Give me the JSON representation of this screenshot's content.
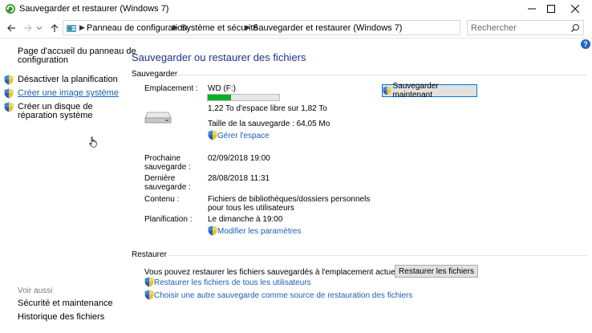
{
  "window": {
    "title": "Sauvegarder et restaurer (Windows 7)"
  },
  "address": {
    "breadcrumbs": [
      "Panneau de configuration",
      "Système et sécurité",
      "Sauvegarder et restaurer (Windows 7)"
    ],
    "search_placeholder": "Rechercher"
  },
  "sidebar": {
    "home_link": "Page d'accueil du panneau de configuration",
    "items": [
      {
        "label": "Désactiver la planification",
        "shield": true
      },
      {
        "label": "Créer une image système",
        "shield": true
      },
      {
        "label": "Créer un disque de réparation système",
        "shield": true
      }
    ],
    "see_also_label": "Voir aussi",
    "see_also_links": [
      "Sécurité et maintenance",
      "Historique des fichiers"
    ]
  },
  "main": {
    "title": "Sauvegarder ou restaurer des fichiers",
    "backup": {
      "section_label": "Sauvegarder",
      "location_label": "Emplacement :",
      "drive_name": "WD (F:)",
      "drive_usage_fraction": 0.33,
      "free_space": "1,22 To d'espace libre sur 1,82 To",
      "backup_size": "Taille de la sauvegarde : 64,05 Mo",
      "manage_space_link": "Gérer l'espace",
      "backup_now_button": "Sauvegarder maintenant",
      "next_backup_label": "Prochaine sauvegarde :",
      "next_backup_value": "02/09/2018 19:00",
      "last_backup_label": "Dernière sauvegarde :",
      "last_backup_value": "28/08/2018 11:31",
      "contents_label": "Contenu :",
      "contents_value": "Fichiers de bibliothèques/dossiers personnels pour tous les utilisateurs",
      "schedule_label": "Planification :",
      "schedule_value": "Le dimanche à 19:00",
      "change_settings_link": "Modifier les paramètres"
    },
    "restore": {
      "section_label": "Restaurer",
      "description": "Vous pouvez restaurer les fichiers sauvegardés à l'emplacement actuel.",
      "restore_button": "Restaurer les fichiers",
      "restore_all_users_link": "Restaurer les fichiers de tous les utilisateurs",
      "choose_other_link": "Choisir une autre sauvegarde comme source de restauration des fichiers"
    }
  },
  "colors": {
    "title_blue": "#1e3287",
    "link_blue": "#1a5fb4",
    "progress_green": "#06b025",
    "help_blue": "#2466c2"
  }
}
